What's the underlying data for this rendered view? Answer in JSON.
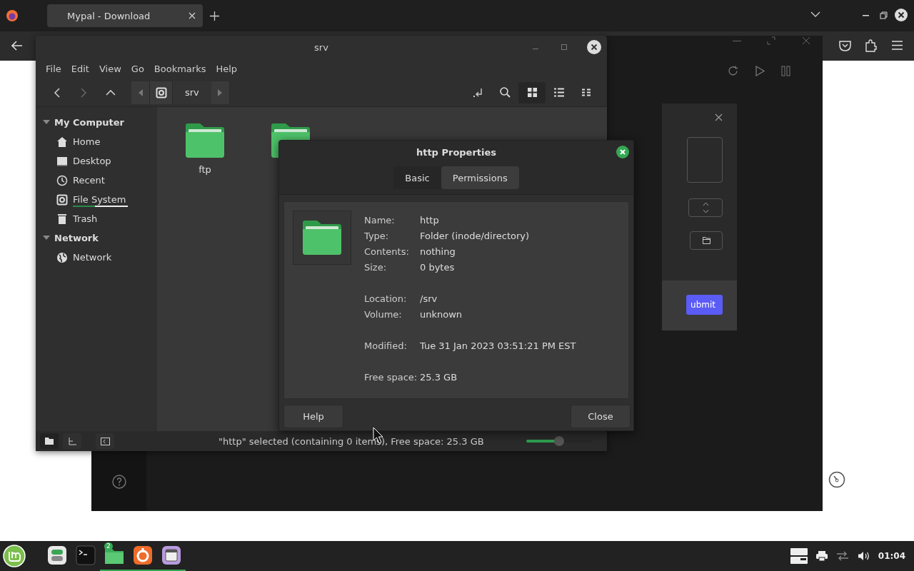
{
  "browser": {
    "tabs": [
      {
        "title": "Mypal - Download",
        "selected": true
      }
    ]
  },
  "background_app": {
    "dialog": {
      "submit_label": "ubmit"
    }
  },
  "file_manager": {
    "title": "srv",
    "menu": [
      "File",
      "Edit",
      "View",
      "Go",
      "Bookmarks",
      "Help"
    ],
    "path": "srv",
    "sidebar": [
      {
        "title": "My Computer",
        "expanded": true,
        "children": [
          {
            "label": "Home",
            "kind": "home"
          },
          {
            "label": "Desktop",
            "kind": "desktop"
          },
          {
            "label": "Recent",
            "kind": "recent"
          },
          {
            "label": "File System",
            "kind": "disk",
            "level": 0.4
          },
          {
            "label": "Trash",
            "kind": "trash"
          }
        ]
      },
      {
        "title": "Network",
        "expanded": true,
        "children": [
          {
            "label": "Network",
            "kind": "globe"
          }
        ]
      }
    ],
    "files": [
      {
        "kind": "folder",
        "name": "ftp"
      },
      {
        "kind": "folder"
      }
    ],
    "status": "\"http\" selected (containing 0 items), Free space: 25.3 GB",
    "zoom": {
      "level": 0.5
    }
  },
  "properties": {
    "title": "http Properties",
    "tabs": [
      {
        "label": "Basic",
        "selected": true
      },
      {
        "label": "Permissions",
        "selected": false
      }
    ],
    "groups": [
      [
        {
          "label": "Name:",
          "value": "http"
        },
        {
          "label": "Type:",
          "value": "Folder (inode/directory)"
        },
        {
          "label": "Contents:",
          "value": "nothing"
        },
        {
          "label": "Size:",
          "value": "0 bytes"
        }
      ],
      [
        {
          "label": "Location:",
          "value": "/srv"
        },
        {
          "label": "Volume:",
          "value": "unknown"
        }
      ],
      [
        {
          "label": "Modified:",
          "value": "Tue 31 Jan 2023 03:51:21 PM EST"
        }
      ],
      [
        {
          "label": "Free space:",
          "value": "25.3 GB"
        }
      ]
    ],
    "buttons": [
      "Help",
      "Close"
    ]
  },
  "taskbar": {
    "apps": [
      {
        "kind": "settings",
        "running": false
      },
      {
        "kind": "terminal",
        "running": false
      },
      {
        "kind": "files",
        "running": true,
        "badge": "2"
      },
      {
        "kind": "browser",
        "running": true
      },
      {
        "kind": "window",
        "running": true
      }
    ],
    "clock": "01:04"
  }
}
